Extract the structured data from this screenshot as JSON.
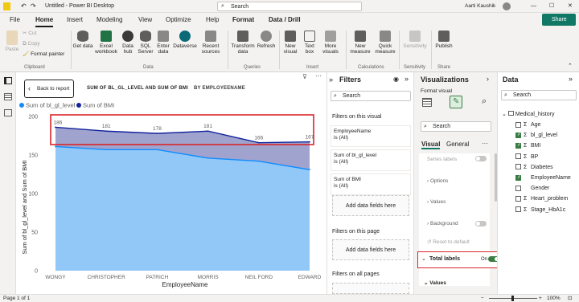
{
  "titlebar": {
    "title": "Untitled - Power BI Desktop",
    "search": "Search",
    "user": "Aarti Kaushik"
  },
  "tabs": [
    "File",
    "Home",
    "Insert",
    "Modeling",
    "View",
    "Optimize",
    "Help",
    "Format",
    "Data / Drill"
  ],
  "share": "Share",
  "ribbon": {
    "clipboard": {
      "paste": "Paste",
      "cut": "Cut",
      "copy": "Copy",
      "format_painter": "Format painter",
      "group": "Clipboard"
    },
    "data": {
      "items": [
        "Get data",
        "Excel workbook",
        "Data hub",
        "SQL Server",
        "Enter data",
        "Dataverse",
        "Recent sources"
      ],
      "group": "Data"
    },
    "queries": {
      "items": [
        "Transform data",
        "Refresh"
      ],
      "group": "Queries"
    },
    "insert": {
      "items": [
        "New visual",
        "Text box",
        "More visuals"
      ],
      "group": "Insert"
    },
    "calculations": {
      "items": [
        "New measure",
        "Quick measure"
      ],
      "group": "Calculations"
    },
    "sensitivity": {
      "items": [
        "Sensitivity"
      ],
      "group": "Sensitivity"
    },
    "share": {
      "items": [
        "Publish"
      ],
      "group": "Share"
    }
  },
  "canvas": {
    "back": "Back to report",
    "title": "SUM OF BL_GL_LEVEL AND SUM OF BMI",
    "by": "BY EMPLOYEENAME"
  },
  "chart_data": {
    "type": "area",
    "categories": [
      "WONGY",
      "CHRISTOPHER",
      "PATRICH",
      "MORRIS",
      "NEIL FORD",
      "EDWARD"
    ],
    "series": [
      {
        "name": "Sum of bl_gl_level",
        "values": [
          161,
          157,
          157,
          146,
          142,
          131
        ],
        "color": "#118dff"
      },
      {
        "name": "Sum of BMI",
        "values": [
          186,
          181,
          178,
          181,
          166,
          167
        ],
        "color": "#12239e"
      }
    ],
    "data_labels": [
      "186",
      "181",
      "178",
      "181",
      "166",
      "167"
    ],
    "yticks": [
      "0",
      "50",
      "100",
      "150",
      "200"
    ],
    "ylim": [
      0,
      200
    ],
    "xlabel": "EmployeeName",
    "ylabel": "Sum of bl_gl_level and Sum of BMI"
  },
  "filters": {
    "title": "Filters",
    "search": "Search",
    "on_visual": "Filters on this visual",
    "cards": [
      {
        "name": "EmployeeName",
        "value": "is (All)"
      },
      {
        "name": "Sum of bl_gl_level",
        "value": "is (All)"
      },
      {
        "name": "Sum of BMI",
        "value": "is (All)"
      }
    ],
    "add": "Add data fields here",
    "on_page": "Filters on this page",
    "on_all": "Filters on all pages"
  },
  "viz": {
    "title": "Visualizations",
    "subtitle": "Format visual",
    "search": "Search",
    "tab_visual": "Visual",
    "tab_general": "General",
    "sections": [
      "Series labels",
      "Options",
      "Values",
      "Background",
      "Reset to default",
      "Total labels",
      "Values"
    ]
  },
  "data": {
    "title": "Data",
    "search": "Search",
    "table": "Medical_history",
    "fields": [
      {
        "name": "Age",
        "checked": false,
        "sigma": true
      },
      {
        "name": "bl_gl_level",
        "checked": true,
        "sigma": true
      },
      {
        "name": "BMI",
        "checked": true,
        "sigma": true
      },
      {
        "name": "BP",
        "checked": false,
        "sigma": true
      },
      {
        "name": "Diabetes",
        "checked": false,
        "sigma": true
      },
      {
        "name": "EmployeeName",
        "checked": true,
        "sigma": false
      },
      {
        "name": "Gender",
        "checked": false,
        "sigma": false
      },
      {
        "name": "Heart_problem",
        "checked": false,
        "sigma": true
      },
      {
        "name": "Stage_HbA1c",
        "checked": false,
        "sigma": true
      }
    ]
  },
  "status": {
    "page": "Page 1 of 1",
    "zoom": "100%"
  }
}
